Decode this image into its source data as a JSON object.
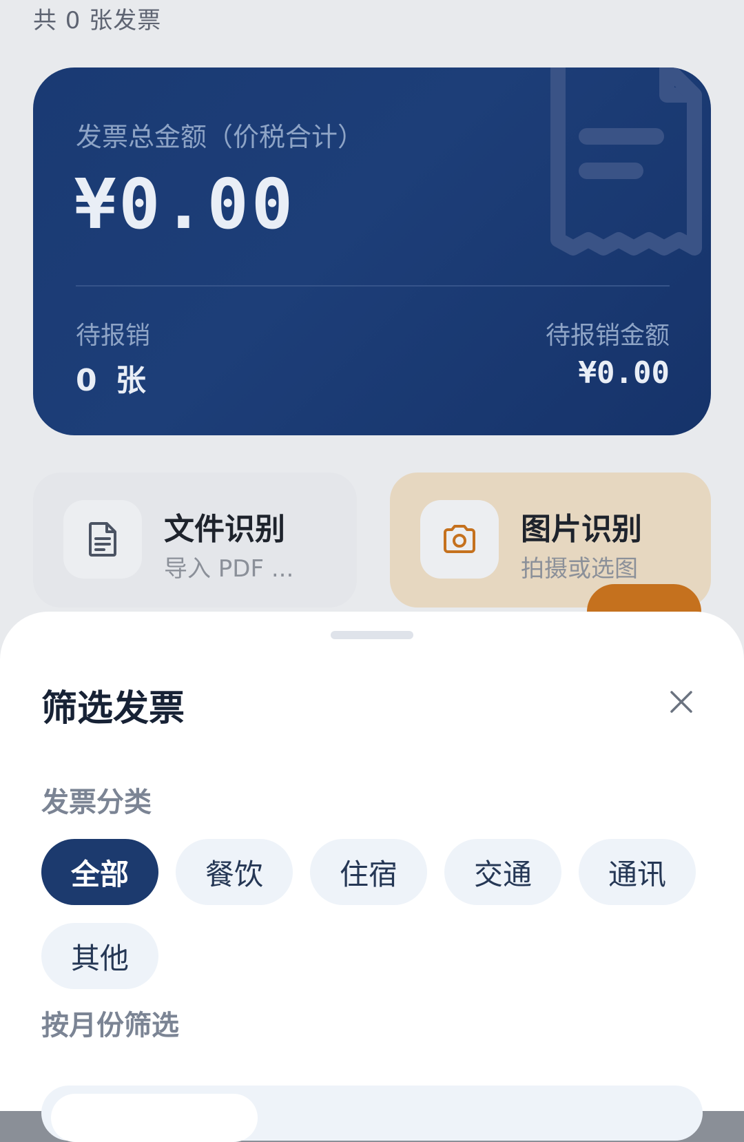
{
  "header": {
    "count_text": "共 0 张发票"
  },
  "summary": {
    "total_label": "发票总金额（价税合计）",
    "total_amount": "¥0.00",
    "pending_label": "待报销",
    "pending_count": "0 张",
    "pending_amount_label": "待报销金额",
    "pending_amount": "¥0.00"
  },
  "actions": {
    "file": {
      "title": "文件识别",
      "subtitle": "导入 PDF ...",
      "icon": "document-icon"
    },
    "image": {
      "title": "图片识别",
      "subtitle": "拍摄或选图",
      "icon": "camera-icon"
    }
  },
  "filter_sheet": {
    "title": "筛选发票",
    "category_label": "发票分类",
    "categories": [
      "全部",
      "餐饮",
      "住宿",
      "交通",
      "通讯",
      "其他"
    ],
    "selected_category": "全部",
    "month_label": "按月份筛选"
  },
  "colors": {
    "card": "#1c3a6e",
    "accent_orange": "#c5711e",
    "chip_bg": "#eef3f9",
    "chip_active": "#1c3a6e"
  }
}
